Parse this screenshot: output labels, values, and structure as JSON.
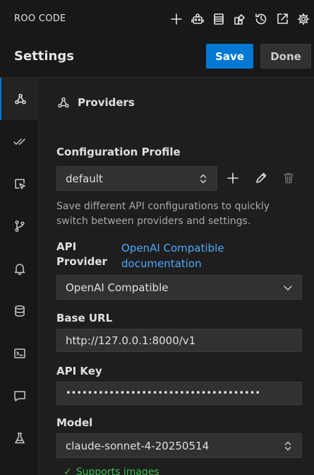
{
  "app": {
    "title": "ROO CODE"
  },
  "header": {
    "title": "Settings",
    "save_label": "Save",
    "done_label": "Done"
  },
  "toolbar_icons": [
    "plus-icon",
    "robot-icon",
    "server-icon",
    "extensions-icon",
    "history-icon",
    "popout-icon",
    "gear-icon"
  ],
  "sidebar": {
    "items": [
      {
        "icon": "webhook-icon",
        "active": true
      },
      {
        "icon": "check-all-icon"
      },
      {
        "icon": "cursor-select-icon"
      },
      {
        "icon": "git-branch-icon"
      },
      {
        "icon": "bell-icon"
      },
      {
        "icon": "database-icon"
      },
      {
        "icon": "terminal-icon"
      },
      {
        "icon": "comment-icon"
      },
      {
        "icon": "beaker-icon"
      }
    ]
  },
  "section": {
    "title": "Providers",
    "icon": "webhook-icon"
  },
  "profile": {
    "label": "Configuration Profile",
    "value": "default",
    "help": "Save different API configurations to quickly switch between providers and settings."
  },
  "provider": {
    "label": "API Provider",
    "link": "OpenAI Compatible documentation",
    "value": "OpenAI Compatible"
  },
  "base_url": {
    "label": "Base URL",
    "value": "http://127.0.0.1:8000/v1"
  },
  "api_key": {
    "label": "API Key",
    "value": "••••••••••••••••••••••••••••••••••••"
  },
  "model": {
    "label": "Model",
    "value": "claude-sonnet-4-20250514"
  },
  "supports": {
    "check": "✓",
    "text": "Supports images"
  },
  "colors": {
    "accent": "#0078d4",
    "link": "#4daafc",
    "background": "#1e1e1e"
  }
}
